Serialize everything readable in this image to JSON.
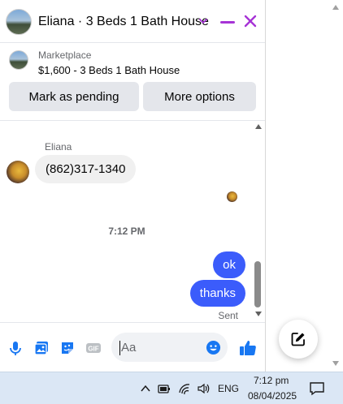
{
  "header": {
    "title": "Eliana · 3 Beds 1 Bath House",
    "avatar_icon": "listing-photo-avatar",
    "chevron_icon": "chevron-down-icon",
    "minimize_icon": "minimize-icon",
    "close_icon": "close-icon",
    "accent_color": "#a633d6"
  },
  "marketplace": {
    "label": "Marketplace",
    "listing": "$1,600 - 3 Beds 1 Bath House",
    "primary_button": "Mark as pending",
    "secondary_button": "More options"
  },
  "messages": {
    "sender_name": "Eliana",
    "incoming": [
      "(862)317-1340"
    ],
    "timestamp": "7:12 PM",
    "outgoing": [
      "ok",
      "thanks"
    ],
    "status": "Sent",
    "outgoing_color": "#3b5cfb"
  },
  "composer": {
    "placeholder": "Aa",
    "icons": [
      "microphone-icon",
      "photo-icon",
      "sticker-icon",
      "gif-icon",
      "emoji-icon",
      "like-icon"
    ],
    "accent_color": "#1877f2"
  },
  "floating": {
    "compose_icon": "new-message-icon"
  },
  "taskbar": {
    "language": "ENG",
    "time": "7:12 pm",
    "date": "08/04/2025"
  }
}
